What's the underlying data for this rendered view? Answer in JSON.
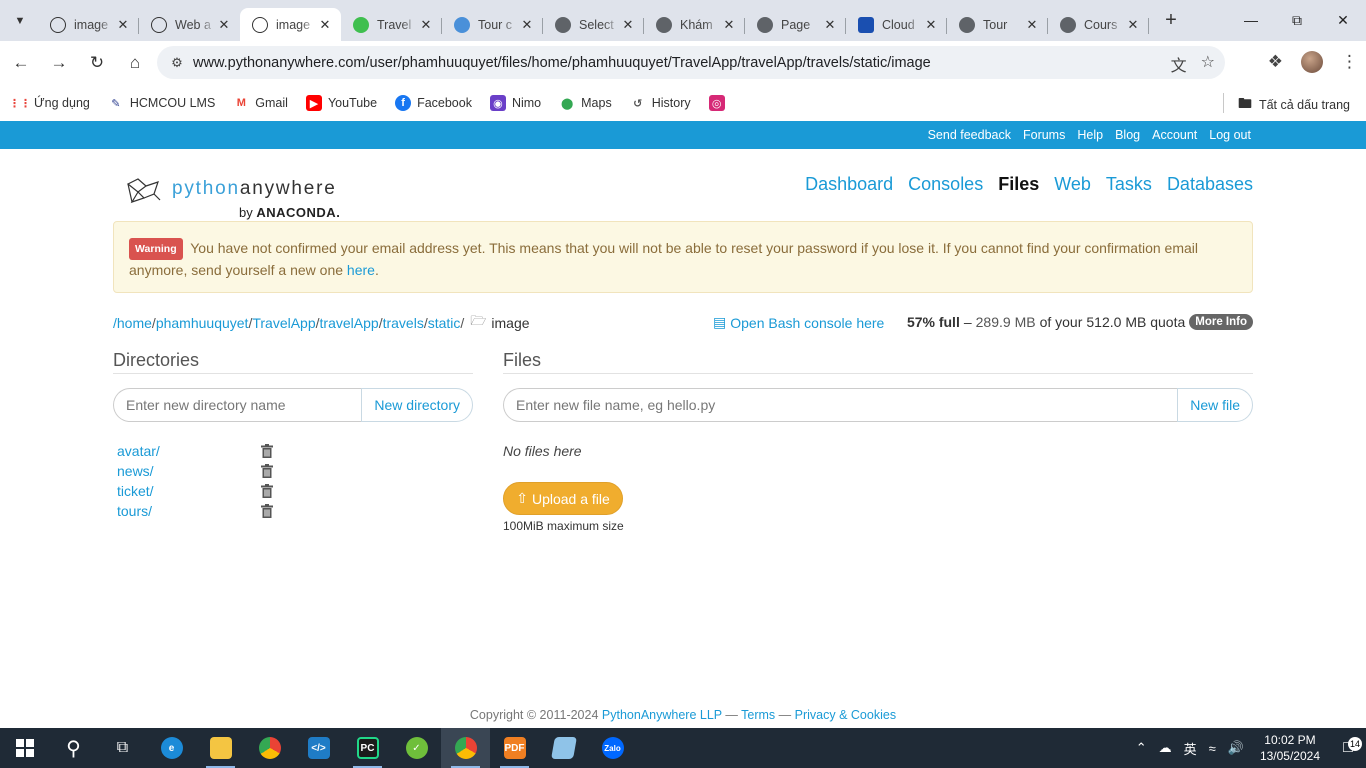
{
  "browser": {
    "tabs": [
      {
        "title": "image",
        "favicon": "pa-icon",
        "active": false
      },
      {
        "title": "Web a",
        "favicon": "pa-icon",
        "active": false
      },
      {
        "title": "image",
        "favicon": "pa-icon",
        "active": true
      },
      {
        "title": "Travel",
        "favicon": "globe-green-icon",
        "active": false
      },
      {
        "title": "Tour c",
        "favicon": "tour-icon",
        "active": false
      },
      {
        "title": "Select",
        "favicon": "globe-icon",
        "active": false
      },
      {
        "title": "Khám",
        "favicon": "globe-icon",
        "active": false
      },
      {
        "title": "Page",
        "favicon": "globe-icon",
        "active": false
      },
      {
        "title": "Cloud",
        "favicon": "cloud-icon",
        "active": false
      },
      {
        "title": "Tour",
        "favicon": "globe-icon",
        "active": false
      },
      {
        "title": "Cours",
        "favicon": "globe-icon",
        "active": false
      }
    ],
    "url": "www.pythonanywhere.com/user/phamhuuquyet/files/home/phamhuuquyet/TravelApp/travelApp/travels/static/image",
    "bookmarks": [
      {
        "label": "Ứng dụng",
        "icon": "apps-grid-icon",
        "color": "#e8453c"
      },
      {
        "label": "HCMCOU LMS",
        "icon": "lms-icon",
        "color": "#2c3e8f"
      },
      {
        "label": "Gmail",
        "icon": "gmail-icon",
        "color": "#ea4335"
      },
      {
        "label": "YouTube",
        "icon": "youtube-icon",
        "color": "#ff0000"
      },
      {
        "label": "Facebook",
        "icon": "facebook-icon",
        "color": "#1877f2"
      },
      {
        "label": "Nimo",
        "icon": "nimo-icon",
        "color": "#6a3fc8"
      },
      {
        "label": "Maps",
        "icon": "maps-icon",
        "color": "#34a853"
      },
      {
        "label": "History",
        "icon": "history-icon",
        "color": "#555555"
      },
      {
        "label": "",
        "icon": "instagram-icon",
        "color": "#d62976"
      }
    ],
    "all_bookmarks_label": "Tất cả dấu trang"
  },
  "topbar": {
    "links": [
      "Send feedback",
      "Forums",
      "Help",
      "Blog",
      "Account",
      "Log out"
    ]
  },
  "logo": {
    "word_light": "python",
    "word_dark": "anywhere",
    "by": "by",
    "brand": "ANACONDA."
  },
  "mainnav": {
    "items": [
      "Dashboard",
      "Consoles",
      "Files",
      "Web",
      "Tasks",
      "Databases"
    ],
    "current": "Files"
  },
  "alert": {
    "badge": "Warning",
    "text": "You have not confirmed your email address yet. This means that you will not be able to reset your password if you lose it. If you cannot find your confirmation email anymore, send yourself a new one",
    "link": "here",
    "trail": "."
  },
  "path": {
    "segments": [
      "/home",
      "phamhuuquyet",
      "TravelApp",
      "travelApp",
      "travels",
      "static"
    ],
    "current": "image",
    "bash_link": "Open Bash console here",
    "quota_pct": "57% full",
    "quota_dash": "–",
    "quota_used": "289.9 MB",
    "quota_of": "of your",
    "quota_total": "512.0 MB quota",
    "more_info": "More Info"
  },
  "directories": {
    "title": "Directories",
    "placeholder": "Enter new directory name",
    "button": "New directory",
    "items": [
      "avatar/",
      "news/",
      "ticket/",
      "tours/"
    ]
  },
  "files": {
    "title": "Files",
    "placeholder": "Enter new file name, eg hello.py",
    "button": "New file",
    "empty": "No files here",
    "upload_button": "Upload a file",
    "upload_note": "100MiB maximum size"
  },
  "footer": {
    "copyright": "Copyright © 2011-2024",
    "company": "PythonAnywhere LLP",
    "dash1": "—",
    "terms": "Terms",
    "dash2": "—",
    "privacy": "Privacy & Cookies"
  },
  "taskbar": {
    "time": "10:02 PM",
    "date": "13/05/2024",
    "notification_count": "14",
    "lang": "英"
  }
}
